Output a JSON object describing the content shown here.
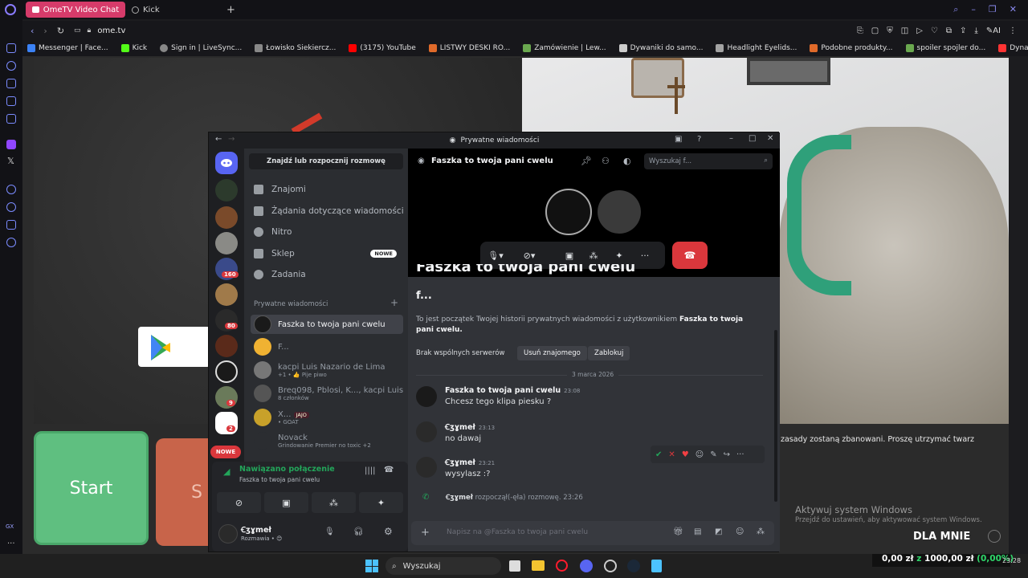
{
  "browser": {
    "tabs": [
      {
        "label": "OmeTV Video Chat —",
        "active": true
      },
      {
        "label": "Kick",
        "active": false
      }
    ],
    "address": "ome.tv",
    "bookmarks": [
      {
        "label": "Messenger | Face...",
        "color": "#3b82f6"
      },
      {
        "label": "Kick",
        "color": "#53fc18"
      },
      {
        "label": "Sign in | LiveSync...",
        "color": "#888888"
      },
      {
        "label": "Łowisko Siekiercz...",
        "color": "#888888"
      },
      {
        "label": "(3175) YouTube",
        "color": "#ff0000"
      },
      {
        "label": "LISTWY DESKI RO...",
        "color": "#e06a2a"
      },
      {
        "label": "Zamówienie | Lew...",
        "color": "#6aa84f"
      },
      {
        "label": "Dywaniki do samo...",
        "color": "#cccccc"
      },
      {
        "label": "Headlight Eyelids...",
        "color": "#a3a3a3"
      },
      {
        "label": "Podobne produkty...",
        "color": "#e06a2a"
      },
      {
        "label": "spoiler spojler do...",
        "color": "#6aa84f"
      },
      {
        "label": "Dynamic Turn Sig...",
        "color": "#ff3333"
      }
    ]
  },
  "page": {
    "start_label": "Start",
    "stop_label": "S",
    "warning_text": "zasady zostaną zbanowani. Proszę utrzymać twarz",
    "activation_title": "Aktywuj system Windows",
    "activation_sub": "Przejdź do ustawień, aby aktywować system Windows.",
    "dla_mnie": "DLA MNIE"
  },
  "discord": {
    "window_title": "Prywatne wiadomości",
    "find_button": "Znajdź lub rozpocznij rozmowę",
    "nav": [
      {
        "label": "Znajomi"
      },
      {
        "label": "Żądania dotyczące wiadomości"
      },
      {
        "label": "Nitro"
      },
      {
        "label": "Sklep",
        "badge": "NOWE"
      },
      {
        "label": "Zadania"
      }
    ],
    "dm_header": "Prywatne wiadomości",
    "dms": [
      {
        "name": "Faszka to twoja pani cwelu",
        "sub": "",
        "active": true
      },
      {
        "name": "F...",
        "sub": ""
      },
      {
        "name": "kacpi Luis Nazario de Lima",
        "sub": "+1 • 👍 Pije piwo"
      },
      {
        "name": "Breq098, Pblosi, K..., kacpi Luis...",
        "sub": "8 członków"
      },
      {
        "name": "X...",
        "sub": "• GOAT",
        "tag": "JAJO"
      },
      {
        "name": "Novack",
        "sub": "Grindowanie Premier no toxic +2"
      }
    ],
    "server_badges": [
      "80",
      "160",
      "80",
      "9",
      "2"
    ],
    "nowe_pill": "NOWE",
    "voice": {
      "status": "Nawiązano połączenie",
      "channel": "Faszka to twoja pani cwelu"
    },
    "user": {
      "name": "Ꞓʒɣmeł",
      "status": "Rozmawia • 😊"
    },
    "chat": {
      "title": "Faszka to twoja pani cwelu",
      "search_placeholder": "Wyszukaj f...",
      "intro_heading": "Faszka to twoja pani cwelu",
      "intro_name": "f...",
      "intro_text": "To jest początek Twojej historii prywatnych wiadomości z użytkownikiem",
      "intro_bold": "Faszka to twoja pani cwelu.",
      "no_servers": "Brak wspólnych serwerów",
      "remove_friend": "Usuń znajomego",
      "block": "Zablokuj",
      "date_divider": "3 marca 2026",
      "messages": [
        {
          "author": "Faszka to twoja pani cwelu",
          "time": "23:08",
          "text": "Chcesz tego klipa piesku ?"
        },
        {
          "author": "Ꞓʒɣmeł",
          "time": "23:13",
          "text": "no dawaj"
        },
        {
          "author": "Ꞓʒɣmeł",
          "time": "23:21",
          "text": "wysylasz :?"
        }
      ],
      "system_message": {
        "author": "Ꞓʒɣmeł",
        "text": "rozpoczął(-ęła) rozmowę.",
        "time": "23:26"
      },
      "composer_placeholder": "Napisz na @Faszka to twoja pani cwelu"
    }
  },
  "taskbar": {
    "search": "Wyszukaj",
    "donation": {
      "current": "0,00 zł",
      "sep": "z",
      "goal": "1000,00 zł",
      "pct": "(0,00%)"
    },
    "clock": "23:28"
  },
  "colors": {
    "discord_blurple": "#5865f2",
    "hangup_red": "#da373c",
    "ometv_pink": "#d63b6a",
    "start_green": "#5fbf80"
  }
}
